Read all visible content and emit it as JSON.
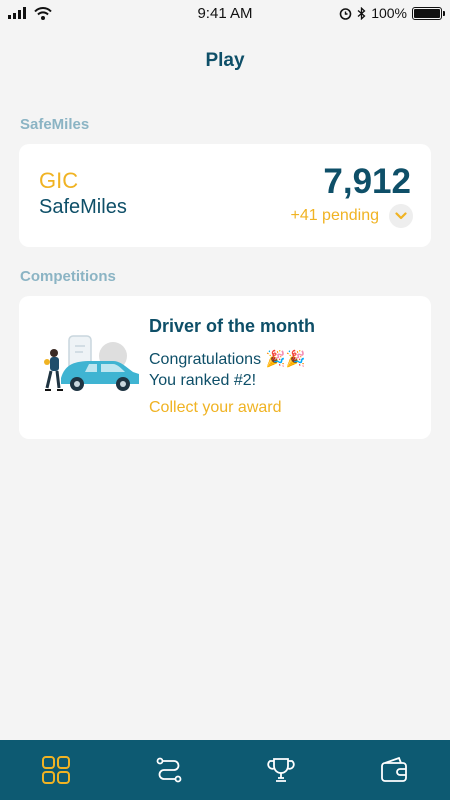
{
  "status_bar": {
    "time": "9:41 AM",
    "battery": "100%",
    "icons": [
      "signal-icon",
      "wifi-icon",
      "alarm-icon",
      "bluetooth-icon",
      "battery-icon"
    ]
  },
  "header": {
    "title": "Play"
  },
  "safemiles_section": {
    "label": "SafeMiles",
    "brand": "GIC",
    "name": "SafeMiles",
    "points": "7,912",
    "pending": "+41 pending",
    "expand_icon": "chevron-down-icon"
  },
  "competitions_section": {
    "label": "Competitions",
    "card": {
      "title": "Driver of the month",
      "message_line1": "Congratulations 🎉🎉",
      "message_line2": "You ranked #2!",
      "cta": "Collect your award"
    }
  },
  "tab_bar": {
    "items": [
      {
        "icon": "grid-icon",
        "active": true
      },
      {
        "icon": "route-icon",
        "active": false
      },
      {
        "icon": "trophy-icon",
        "active": false
      },
      {
        "icon": "wallet-icon",
        "active": false
      }
    ]
  },
  "colors": {
    "primary": "#0e4f68",
    "accent": "#f0b323",
    "section_label": "#8bb4c4",
    "tab_bar": "#0d5a72",
    "background": "#f4f4f4"
  }
}
